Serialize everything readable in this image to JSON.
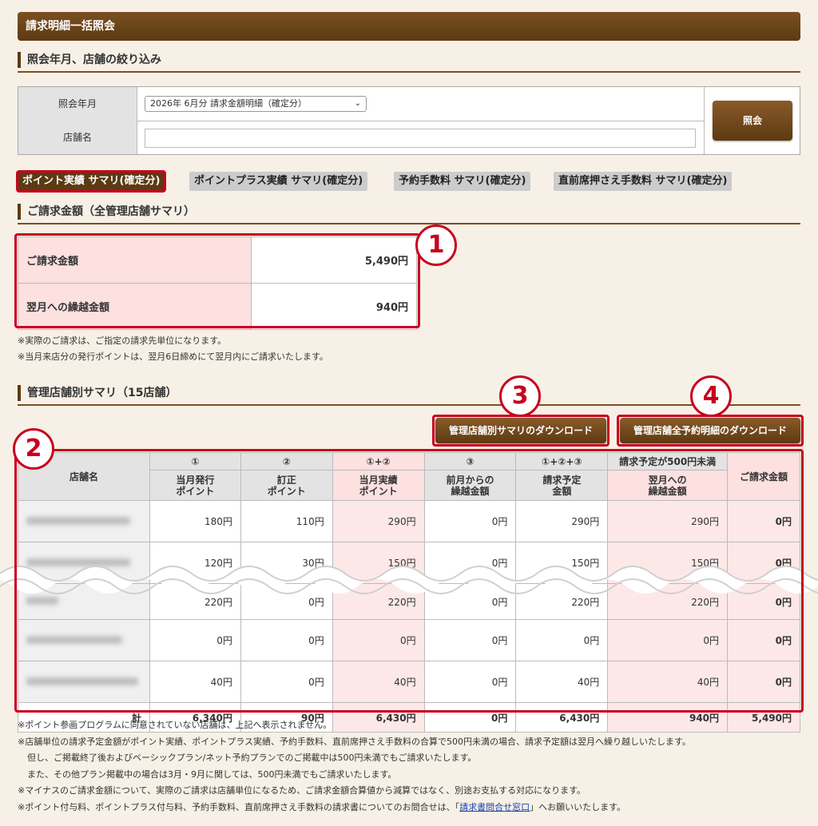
{
  "header": {
    "title": "請求明細一括照会"
  },
  "filter_section": {
    "title": "照会年月、店舗の絞り込み",
    "period_label": "照会年月",
    "period_value": "2026年 6月分 請求金額明細（確定分）",
    "store_label": "店舗名",
    "store_value": "",
    "search_button": "照会"
  },
  "tabs": [
    {
      "label": "ポイント実績 サマリ(確定分)",
      "active": true
    },
    {
      "label": "ポイントプラス実績 サマリ(確定分)",
      "active": false
    },
    {
      "label": "予約手数料 サマリ(確定分)",
      "active": false
    },
    {
      "label": "直前席押さえ手数料 サマリ(確定分)",
      "active": false
    }
  ],
  "billing_section": {
    "title": "ご請求金額（全管理店舗サマリ）",
    "rows": [
      {
        "label": "ご請求金額",
        "value": "5,490円"
      },
      {
        "label": "翌月への繰越金額",
        "value": "940円"
      }
    ],
    "notes": [
      "※実際のご請求は、ご指定の請求先単位になります。",
      "※当月来店分の発行ポイントは、翌月6日締めにて翌月内にご請求いたします。"
    ]
  },
  "store_section": {
    "title": "管理店舗別サマリ（15店舗）",
    "download_summary": "管理店舗別サマリのダウンロード",
    "download_details": "管理店舗全予約明細のダウンロード",
    "header_top": [
      "①",
      "②",
      "①+②",
      "③",
      "①+②+③",
      "請求予定が500円未満"
    ],
    "header_store": "店舗名",
    "header_bottom": [
      "当月発行\nポイント",
      "訂正\nポイント",
      "当月実績\nポイント",
      "前月からの\n繰越金額",
      "請求予定\n金額",
      "翌月への\n繰越金額"
    ],
    "header_total": "ご請求金額",
    "rows": [
      [
        "180円",
        "110円",
        "290円",
        "0円",
        "290円",
        "290円",
        "0円"
      ],
      [
        "120円",
        "30円",
        "150円",
        "0円",
        "150円",
        "150円",
        "0円"
      ],
      [
        "220円",
        "0円",
        "220円",
        "0円",
        "220円",
        "220円",
        "0円"
      ],
      [
        "0円",
        "0円",
        "0円",
        "0円",
        "0円",
        "0円",
        "0円"
      ],
      [
        "40円",
        "0円",
        "40円",
        "0円",
        "40円",
        "40円",
        "0円"
      ]
    ],
    "total_label": "計",
    "totals": [
      "6,340円",
      "90円",
      "6,430円",
      "0円",
      "6,430円",
      "940円",
      "5,490円"
    ]
  },
  "badges": [
    "1",
    "2",
    "3",
    "4"
  ],
  "footer_notes": {
    "n1": "※ポイント参画プログラムに同意されていない店舗は、上記へ表示されません。",
    "n2": "※店舗単位の請求予定金額がポイント実績、ポイントプラス実績、予約手数料、直前席押さえ手数料の合算で500円未満の場合、請求予定額は翌月へ繰り越しいたします。",
    "n3": "但し、ご掲載終了後およびベーシックプラン/ネット予約プランでのご掲載中は500円未満でもご請求いたします。",
    "n4": "また、その他プラン掲載中の場合は3月・9月に関しては、500円未満でもご請求いたします。",
    "n5": "※マイナスのご請求金額について、実際のご請求は店舗単位になるため、ご請求金額合算値から減算ではなく、別途お支払する対応になります。",
    "n6_pre": "※ポイント付与料、ポイントプラス付与料、予約手数料、直前席押さえ手数料の請求書についてのお問合せは、「",
    "n6_link": "請求書問合せ窓口",
    "n6_post": "」へお願いいたします。"
  },
  "colors": {
    "brand": "#5c3a12",
    "highlight": "#c8001e",
    "pink": "#fde0e0"
  }
}
